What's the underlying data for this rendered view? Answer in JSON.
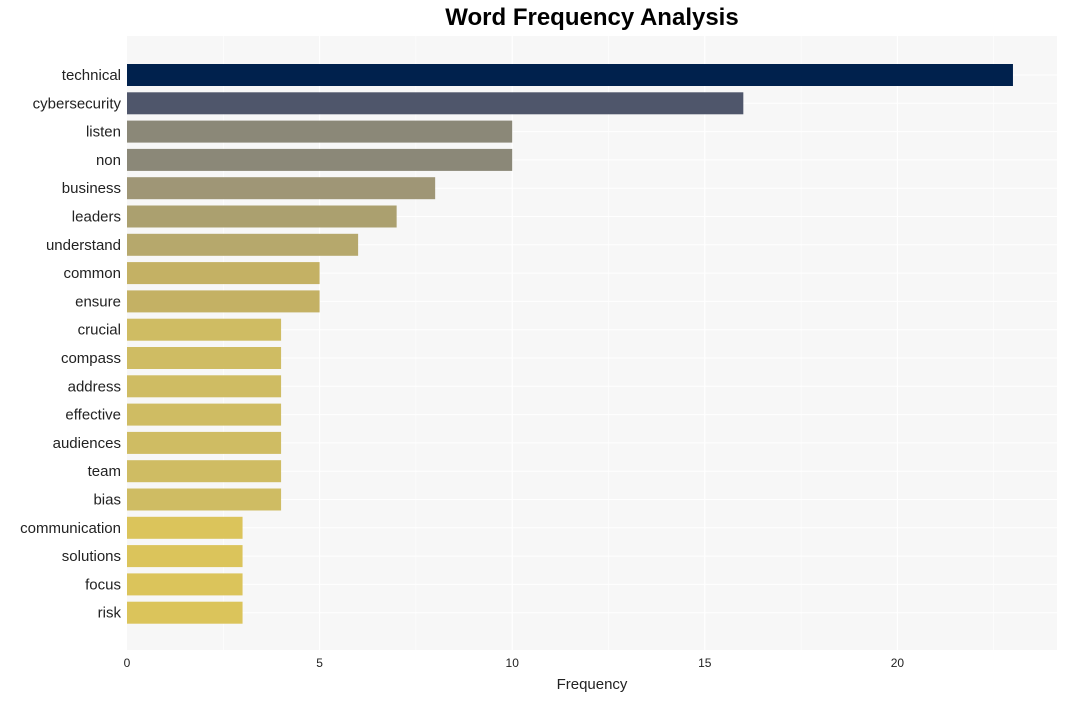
{
  "chart_data": {
    "type": "bar",
    "orientation": "horizontal",
    "title": "Word Frequency Analysis",
    "xlabel": "Frequency",
    "ylabel": "",
    "xlim": [
      0,
      24.2
    ],
    "xticks": [
      0,
      5,
      10,
      15,
      20
    ],
    "grid": true,
    "categories": [
      "technical",
      "cybersecurity",
      "listen",
      "non",
      "business",
      "leaders",
      "understand",
      "common",
      "ensure",
      "crucial",
      "compass",
      "address",
      "effective",
      "audiences",
      "team",
      "bias",
      "communication",
      "solutions",
      "focus",
      "risk"
    ],
    "values": [
      23,
      16,
      10,
      10,
      8,
      7,
      6,
      5,
      5,
      4,
      4,
      4,
      4,
      4,
      4,
      4,
      3,
      3,
      3,
      3
    ],
    "colors": [
      "#00214d",
      "#4f566b",
      "#8b8878",
      "#8b8878",
      "#9f9676",
      "#aba06f",
      "#b6a86c",
      "#c4b164",
      "#c4b164",
      "#cfbc63",
      "#cfbc63",
      "#cfbc63",
      "#cfbc63",
      "#cfbc63",
      "#cfbc63",
      "#cfbc63",
      "#dbc45b",
      "#dbc45b",
      "#dbc45b",
      "#dbc45b"
    ]
  }
}
